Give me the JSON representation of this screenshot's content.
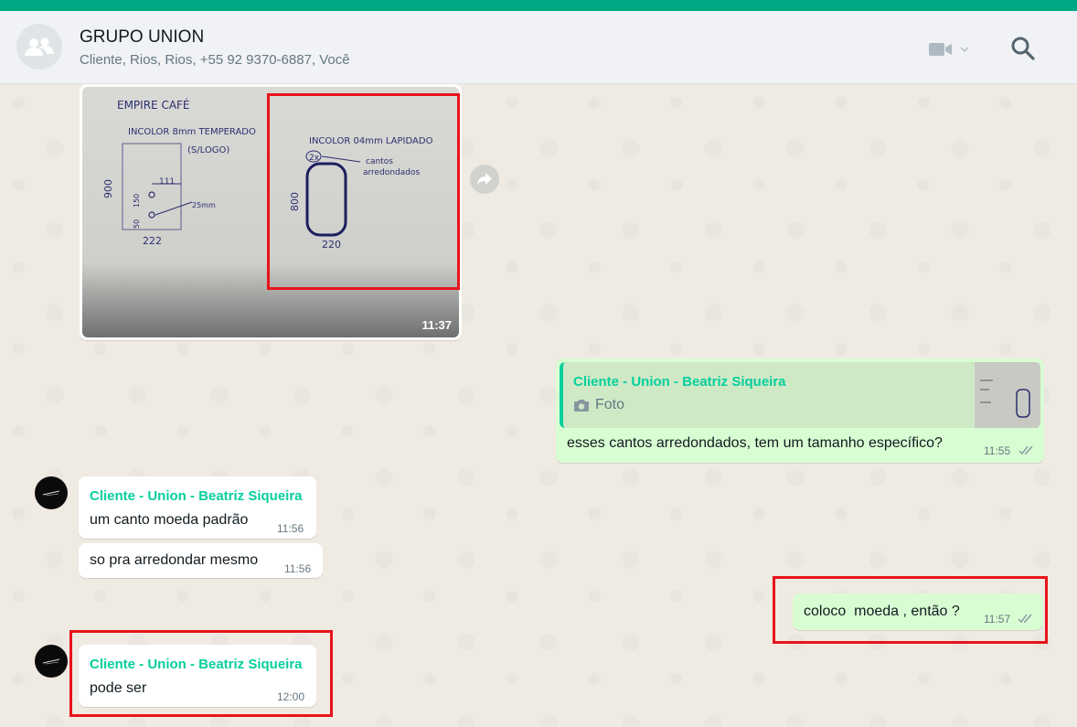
{
  "header": {
    "title": "GRUPO UNION",
    "participants": "Cliente, Rios, Rios, +55 92 9370-6887, Você",
    "icons": [
      "group-avatar-icon",
      "video-call-icon",
      "chevron-down-icon",
      "search-icon"
    ]
  },
  "messages": [
    {
      "type": "image",
      "direction": "in",
      "time": "11:37",
      "image_text": {
        "title": "EMPIRE CAFÉ",
        "left_label": "INCOLOR 8mm TEMPERADO",
        "left_sub": "(S/LOGO)",
        "left_width": "222",
        "left_height": "900",
        "dim_a": "111",
        "dim_b": "150",
        "dim_c": "50",
        "hole": "25mm",
        "right_label": "INCOLOR 04mm LAPIDADO",
        "qty": "2x",
        "note_line1": "cantos",
        "note_line2": "arredondados",
        "right_height": "800",
        "right_width": "220"
      }
    },
    {
      "type": "reply",
      "direction": "out",
      "quoted_sender": "Cliente - Union - Beatriz Siqueira",
      "quoted_type": "Foto",
      "text": "esses cantos arredondados, tem um tamanho específico?",
      "time": "11:55"
    },
    {
      "type": "text",
      "direction": "in",
      "sender": "Cliente - Union - Beatriz Siqueira",
      "text": "um canto moeda padrão",
      "time": "11:56"
    },
    {
      "type": "text",
      "direction": "in",
      "text": "so pra arredondar mesmo",
      "time": "11:56"
    },
    {
      "type": "text",
      "direction": "out",
      "text": "coloco  moeda , então ?",
      "time": "11:57"
    },
    {
      "type": "text",
      "direction": "in",
      "sender": "Cliente - Union - Beatriz Siqueira",
      "text": "pode ser",
      "time": "12:00"
    }
  ],
  "colors": {
    "accent": "#00a884",
    "sender_name": "#06cf9c",
    "outgoing_bubble": "#d9fdd3",
    "highlight": "#e8141b",
    "read_ticks": "#8696a0"
  }
}
